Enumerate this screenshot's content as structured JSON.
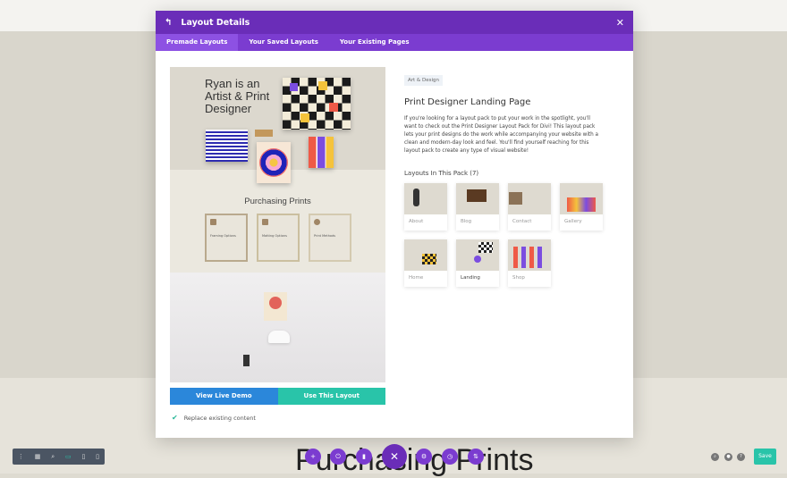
{
  "modal": {
    "title": "Layout Details",
    "tabs": [
      "Premade Layouts",
      "Your Saved Layouts",
      "Your Existing Pages"
    ]
  },
  "preview": {
    "hero_title": "Ryan is an Artist & Print Designer",
    "section_title": "Purchasing Prints",
    "cards": [
      {
        "title": "Framing Options"
      },
      {
        "title": "Matting Options"
      },
      {
        "title": "Print Methods"
      }
    ]
  },
  "buttons": {
    "demo": "View Live Demo",
    "use": "Use This Layout"
  },
  "replace_label": "Replace existing content",
  "info": {
    "tag": "Art & Design",
    "title": "Print Designer Landing Page",
    "description": "If you're looking for a layout pack to put your work in the spotlight, you'll want to check out the Print Designer Layout Pack for Divi! This layout pack lets your print designs do the work while accompanying your website with a clean and modern-day look and feel. You'll find yourself reaching for this layout pack to create any type of visual website!",
    "layouts_heading": "Layouts In This Pack (7)",
    "layouts": [
      "About",
      "Blog",
      "Contact",
      "Gallery",
      "Home",
      "Landing",
      "Shop"
    ]
  },
  "page": {
    "background_heading": "Purchasing Prints",
    "save_label": "Save"
  },
  "colors": {
    "purple": "#6a2db8",
    "blue": "#2b87da",
    "green": "#29c4a9"
  }
}
